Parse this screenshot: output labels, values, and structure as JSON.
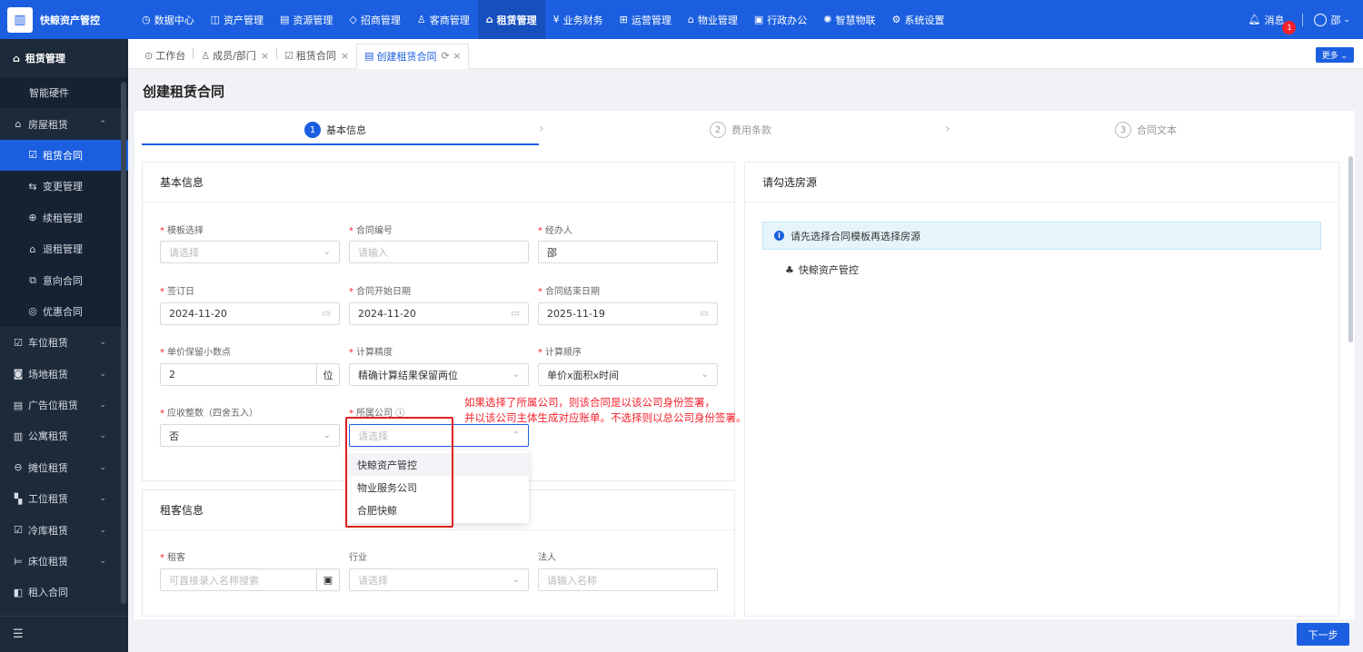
{
  "app": {
    "name": "快鲸资产管控"
  },
  "nav": [
    {
      "icon": "◷",
      "label": "数据中心"
    },
    {
      "icon": "◫",
      "label": "资产管理"
    },
    {
      "icon": "▤",
      "label": "资源管理"
    },
    {
      "icon": "◇",
      "label": "招商管理"
    },
    {
      "icon": "♙",
      "label": "客商管理"
    },
    {
      "icon": "⌂",
      "label": "租赁管理"
    },
    {
      "icon": "¥",
      "label": "业务财务"
    },
    {
      "icon": "⊞",
      "label": "运营管理"
    },
    {
      "icon": "⌂",
      "label": "物业管理"
    },
    {
      "icon": "▣",
      "label": "行政办公"
    },
    {
      "icon": "✺",
      "label": "智慧物联"
    },
    {
      "icon": "⚙",
      "label": "系统设置"
    }
  ],
  "top_right": {
    "messages_label": "消息",
    "messages_badge": "1",
    "user": "邵"
  },
  "sidebar": {
    "title": "租赁管理",
    "items": [
      {
        "label": "智能硬件",
        "icon": ""
      },
      {
        "label": "房屋租赁",
        "icon": "⌂",
        "chev": "⌃"
      },
      {
        "label": "租赁合同",
        "icon": "☑"
      },
      {
        "label": "变更管理",
        "icon": "⇆"
      },
      {
        "label": "续租管理",
        "icon": "⊕"
      },
      {
        "label": "退租管理",
        "icon": "⌂"
      },
      {
        "label": "意向合同",
        "icon": "⧉"
      },
      {
        "label": "优惠合同",
        "icon": "◎"
      },
      {
        "label": "车位租赁",
        "icon": "☑",
        "chev": "⌄"
      },
      {
        "label": "场地租赁",
        "icon": "◙",
        "chev": "⌄"
      },
      {
        "label": "广告位租赁",
        "icon": "▤",
        "chev": "⌄"
      },
      {
        "label": "公寓租赁",
        "icon": "▥",
        "chev": "⌄"
      },
      {
        "label": "摊位租赁",
        "icon": "⊖",
        "chev": "⌄"
      },
      {
        "label": "工位租赁",
        "icon": "▚",
        "chev": "⌄"
      },
      {
        "label": "冷库租赁",
        "icon": "☑",
        "chev": "⌄"
      },
      {
        "label": "床位租赁",
        "icon": "⊨",
        "chev": "⌄"
      },
      {
        "label": "租入合同",
        "icon": "◧"
      }
    ],
    "collapse_icon": "☰"
  },
  "tabs": [
    {
      "icon": "⊙",
      "label": "工作台",
      "close": ""
    },
    {
      "icon": "♙",
      "label": "成员/部门",
      "close": "×"
    },
    {
      "icon": "☑",
      "label": "租赁合同",
      "close": "×"
    },
    {
      "icon": "▤",
      "label": "创建租赁合同",
      "close": "⟳ ×"
    }
  ],
  "more_label": "更多 ⌄",
  "page_title": "创建租赁合同",
  "steps": [
    {
      "num": "1",
      "label": "基本信息"
    },
    {
      "num": "2",
      "label": "费用条款"
    },
    {
      "num": "3",
      "label": "合同文本"
    }
  ],
  "basic": {
    "title": "基本信息",
    "template_label": "模板选择",
    "template_ph": "请选择",
    "contract_no_label": "合同编号",
    "contract_no_ph": "请输入",
    "handler_label": "经办人",
    "handler_value": "邵",
    "sign_date_label": "签订日",
    "sign_date": "2024-11-20",
    "start_label": "合同开始日期",
    "start_date": "2024-11-20",
    "end_label": "合同结束日期",
    "end_date": "2025-11-19",
    "decimal_label": "单价保留小数点",
    "decimal_value": "2",
    "decimal_unit": "位",
    "precision_label": "计算精度",
    "precision_value": "精确计算结果保留两位",
    "order_label": "计算顺序",
    "order_value": "单价x面积x时间",
    "round_label": "应收整数（四舍五入）",
    "round_value": "否",
    "company_label": "所属公司",
    "company_ph": "请选择"
  },
  "company_options": [
    "快鲸资产管控",
    "物业服务公司",
    "合肥快鲸"
  ],
  "note": [
    "如果选择了所属公司，则该合同是以该公司身份签署，",
    "并以该公司主体生成对应账单。不选择则以总公司身份签署。"
  ],
  "tenant": {
    "title": "租客信息",
    "tenant_label": "租客",
    "tenant_ph": "可直接录入名称搜索",
    "industry_label": "行业",
    "industry_ph": "请选择",
    "legal_label": "法人",
    "legal_ph": "请输入名称"
  },
  "house": {
    "title": "请勾选房源",
    "info": "请先选择合同模板再选择房源",
    "tree_root": "快鲸资产管控"
  },
  "next_label": "下一步"
}
